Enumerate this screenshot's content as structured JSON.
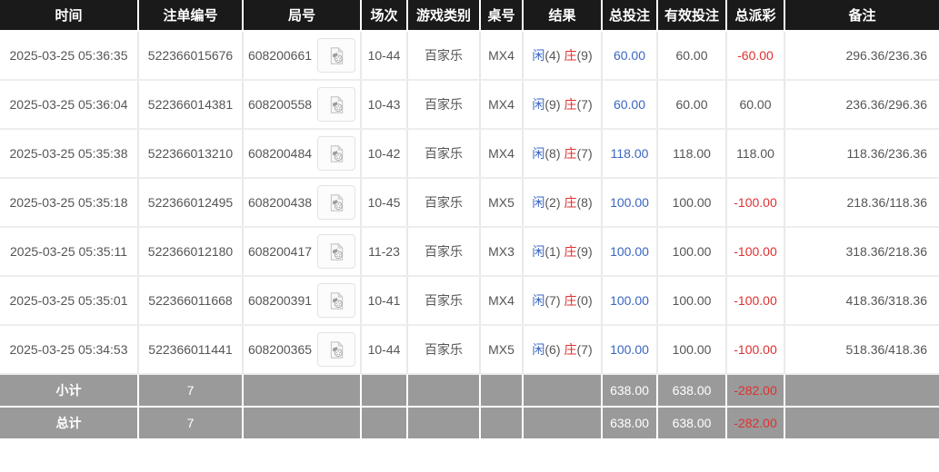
{
  "colors": {
    "header_bg": "#1a1a1a",
    "header_text": "#ffffff",
    "footer_bg": "#9a9a9a",
    "bet_blue": "#3a66c2",
    "loss_red": "#e03030",
    "body_text": "#555555"
  },
  "icons": {
    "round_replay": "video-file-icon"
  },
  "table": {
    "columns": [
      {
        "key": "time",
        "label": "时间"
      },
      {
        "key": "bet-id",
        "label": "注单编号"
      },
      {
        "key": "round-id",
        "label": "局号"
      },
      {
        "key": "session",
        "label": "场次"
      },
      {
        "key": "game-type",
        "label": "游戏类别"
      },
      {
        "key": "table-no",
        "label": "桌号"
      },
      {
        "key": "result",
        "label": "结果"
      },
      {
        "key": "total-bet",
        "label": "总投注"
      },
      {
        "key": "valid-bet",
        "label": "有效投注"
      },
      {
        "key": "payout",
        "label": "总派彩"
      },
      {
        "key": "remark",
        "label": "备注"
      }
    ],
    "rows": [
      {
        "time": "2025-03-25 05:36:35",
        "bet_id": "522366015676",
        "round_id": "608200661",
        "session": "10-44",
        "game_type": "百家乐",
        "table_no": "MX4",
        "player": "闲",
        "player_score": "(4)",
        "banker": "庄",
        "banker_score": "(9)",
        "total_bet": "60.00",
        "valid_bet": "60.00",
        "payout": "-60.00",
        "remark": "296.36/236.36"
      },
      {
        "time": "2025-03-25 05:36:04",
        "bet_id": "522366014381",
        "round_id": "608200558",
        "session": "10-43",
        "game_type": "百家乐",
        "table_no": "MX4",
        "player": "闲",
        "player_score": "(9)",
        "banker": "庄",
        "banker_score": "(7)",
        "total_bet": "60.00",
        "valid_bet": "60.00",
        "payout": "60.00",
        "remark": "236.36/296.36"
      },
      {
        "time": "2025-03-25 05:35:38",
        "bet_id": "522366013210",
        "round_id": "608200484",
        "session": "10-42",
        "game_type": "百家乐",
        "table_no": "MX4",
        "player": "闲",
        "player_score": "(8)",
        "banker": "庄",
        "banker_score": "(7)",
        "total_bet": "118.00",
        "valid_bet": "118.00",
        "payout": "118.00",
        "remark": "118.36/236.36"
      },
      {
        "time": "2025-03-25 05:35:18",
        "bet_id": "522366012495",
        "round_id": "608200438",
        "session": "10-45",
        "game_type": "百家乐",
        "table_no": "MX5",
        "player": "闲",
        "player_score": "(2)",
        "banker": "庄",
        "banker_score": "(8)",
        "total_bet": "100.00",
        "valid_bet": "100.00",
        "payout": "-100.00",
        "remark": "218.36/118.36"
      },
      {
        "time": "2025-03-25 05:35:11",
        "bet_id": "522366012180",
        "round_id": "608200417",
        "session": "11-23",
        "game_type": "百家乐",
        "table_no": "MX3",
        "player": "闲",
        "player_score": "(1)",
        "banker": "庄",
        "banker_score": "(9)",
        "total_bet": "100.00",
        "valid_bet": "100.00",
        "payout": "-100.00",
        "remark": "318.36/218.36"
      },
      {
        "time": "2025-03-25 05:35:01",
        "bet_id": "522366011668",
        "round_id": "608200391",
        "session": "10-41",
        "game_type": "百家乐",
        "table_no": "MX4",
        "player": "闲",
        "player_score": "(7)",
        "banker": "庄",
        "banker_score": "(0)",
        "total_bet": "100.00",
        "valid_bet": "100.00",
        "payout": "-100.00",
        "remark": "418.36/318.36"
      },
      {
        "time": "2025-03-25 05:34:53",
        "bet_id": "522366011441",
        "round_id": "608200365",
        "session": "10-44",
        "game_type": "百家乐",
        "table_no": "MX5",
        "player": "闲",
        "player_score": "(6)",
        "banker": "庄",
        "banker_score": "(7)",
        "total_bet": "100.00",
        "valid_bet": "100.00",
        "payout": "-100.00",
        "remark": "518.36/418.36"
      }
    ],
    "footer": [
      {
        "label": "小计",
        "count": "7",
        "total_bet": "638.00",
        "valid_bet": "638.00",
        "payout": "-282.00"
      },
      {
        "label": "总计",
        "count": "7",
        "total_bet": "638.00",
        "valid_bet": "638.00",
        "payout": "-282.00"
      }
    ]
  }
}
